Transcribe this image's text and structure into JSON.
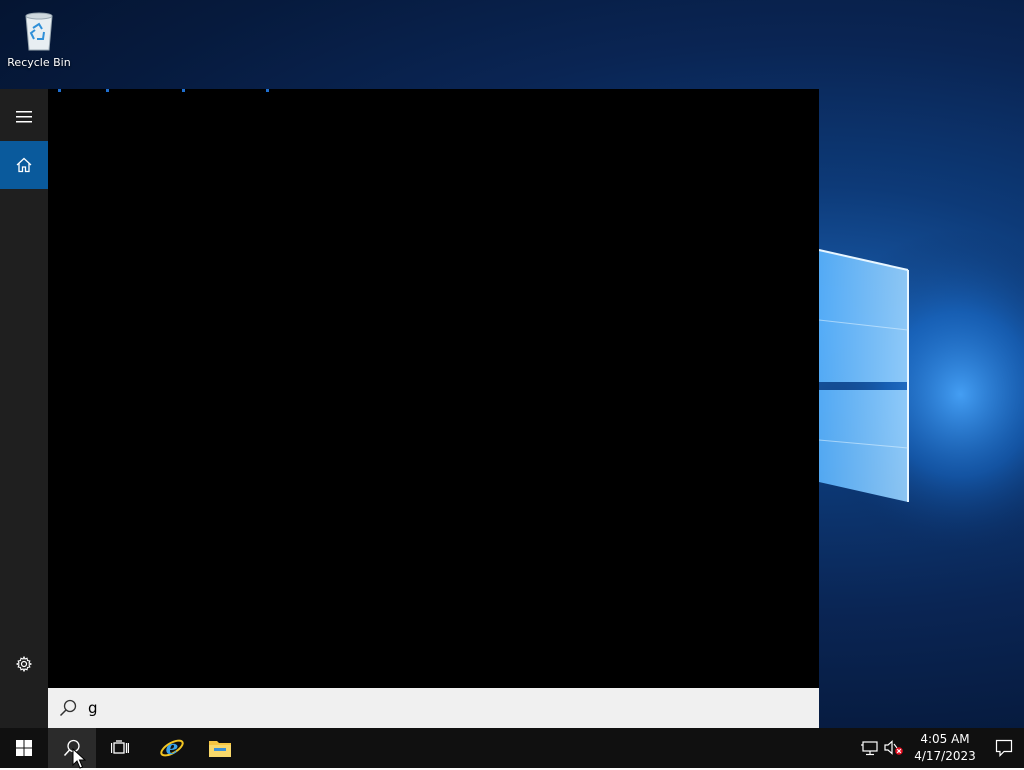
{
  "desktop": {
    "icons": [
      {
        "label": "Recycle Bin",
        "icon": "recycle-bin-icon"
      }
    ]
  },
  "start_panel": {
    "rail": {
      "menu_icon": "hamburger-menu-icon",
      "home_icon": "home-icon",
      "settings_icon": "gear-icon"
    },
    "accent_color": "#0a5a9c"
  },
  "search": {
    "value": "g",
    "icon": "search-icon"
  },
  "taskbar": {
    "pinned": [
      {
        "name": "start",
        "icon": "windows-logo-icon"
      },
      {
        "name": "search",
        "icon": "search-icon"
      },
      {
        "name": "task-view",
        "icon": "task-view-icon"
      },
      {
        "name": "internet-explorer",
        "icon": "internet-explorer-icon"
      },
      {
        "name": "file-explorer",
        "icon": "folder-icon"
      }
    ],
    "tray": {
      "network_icon": "network-icon",
      "volume_icon": "volume-muted-icon",
      "time": "4:05 AM",
      "date": "4/17/2023",
      "notification_icon": "action-center-icon"
    }
  }
}
